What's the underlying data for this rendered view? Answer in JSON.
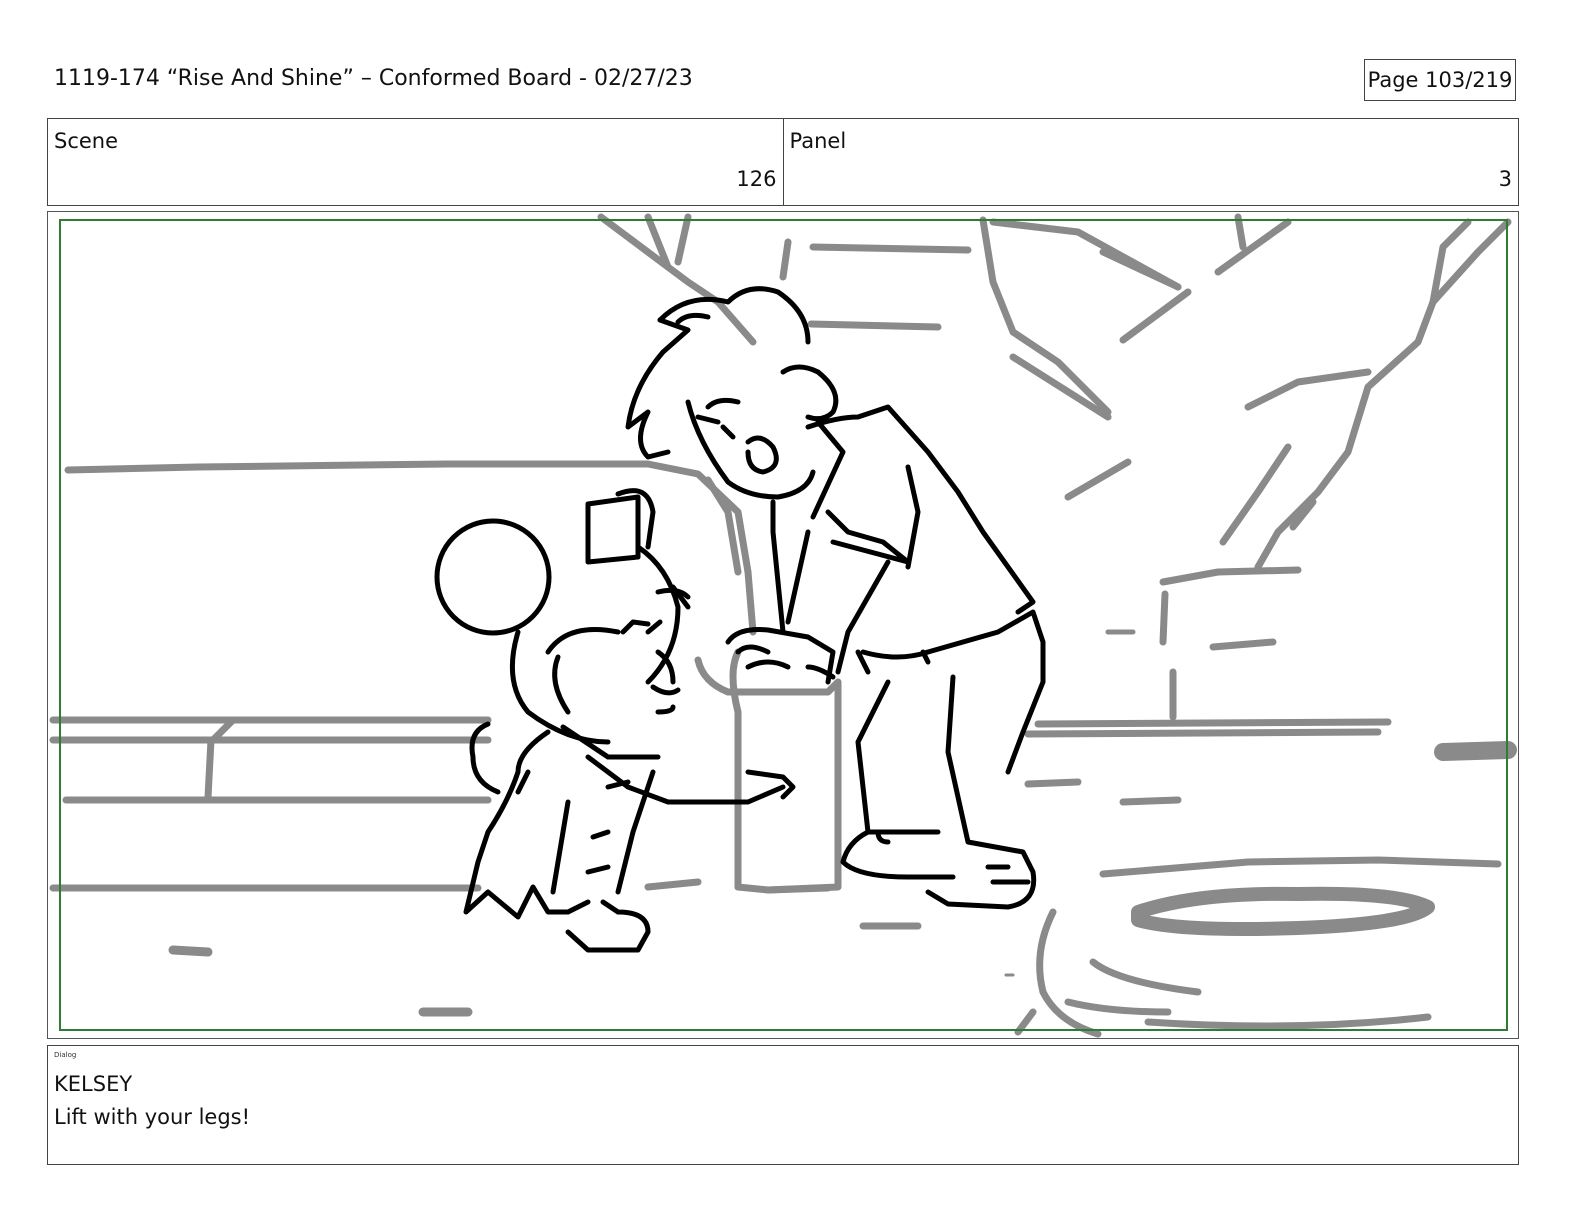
{
  "header": {
    "title": "1119-174 “Rise And Shine” – Conformed Board - 02/27/23",
    "page": "Page 103/219"
  },
  "scene": {
    "label": "Scene",
    "value": "126"
  },
  "panel": {
    "label": "Panel",
    "value": "3"
  },
  "artwork": {
    "description_icon": "storyboard-sketch",
    "safe_area_color": "#2e7d32",
    "background_line_color": "#8a8a8a",
    "character_line_color": "#000000"
  },
  "dialog": {
    "tag": "Dialog",
    "character": "KELSEY",
    "line": "Lift with your legs!"
  }
}
